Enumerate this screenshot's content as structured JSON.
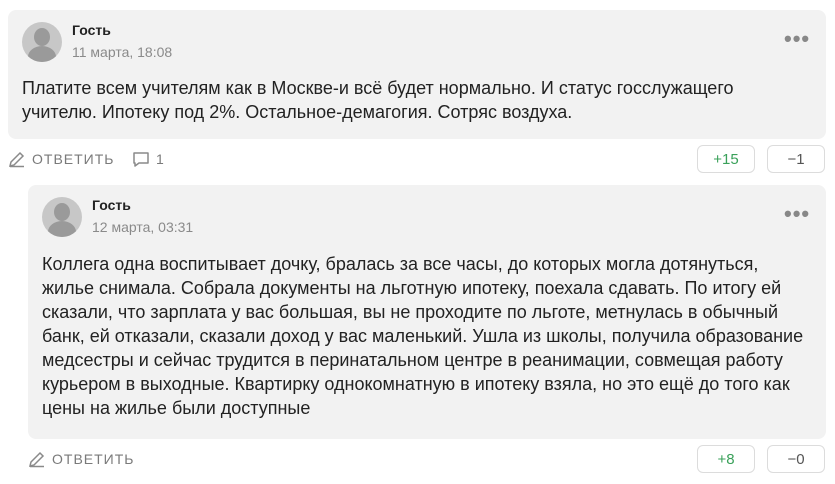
{
  "comments": [
    {
      "author": "Гость",
      "date": "11 марта, 18:08",
      "text": "Платите всем учителям как в Москве-и всё будет нормально. И статус госслужащего учителю. Ипотеку под 2%. Остальное-демагогия. Сотряс воздуха.",
      "reply_label": "ОТВЕТИТЬ",
      "replies_count": "1",
      "upvotes": "+15",
      "downvotes": "−1"
    },
    {
      "author": "Гость",
      "date": "12 марта, 03:31",
      "text": "Коллега одна воспитывает дочку, бралась за все часы, до которых могла дотянуться, жилье снимала. Собрала документы на льготную ипотеку, поехала сдавать. По итогу ей сказали, что зарплата у вас большая, вы не проходите по льготе, метнулась в обычный банк, ей отказали, сказали доход у вас маленький. Ушла из школы, получила образование медсестры и сейчас трудится в перинатальном центре в реанимации, совмещая работу курьером в выходные. Квартирку однокомнатную в ипотеку взяла, но это ещё до того как цены на жилье были доступные",
      "reply_label": "ОТВЕТИТЬ",
      "upvotes": "+8",
      "downvotes": "−0"
    }
  ],
  "icons": {
    "avatar": "user-avatar-icon",
    "more": "more-dots-icon",
    "reply": "pencil-icon",
    "comments": "comment-bubble-icon"
  },
  "colors": {
    "card_bg": "#f2f2f2",
    "upvote": "#3aa15a",
    "muted": "#8a8a8a"
  }
}
